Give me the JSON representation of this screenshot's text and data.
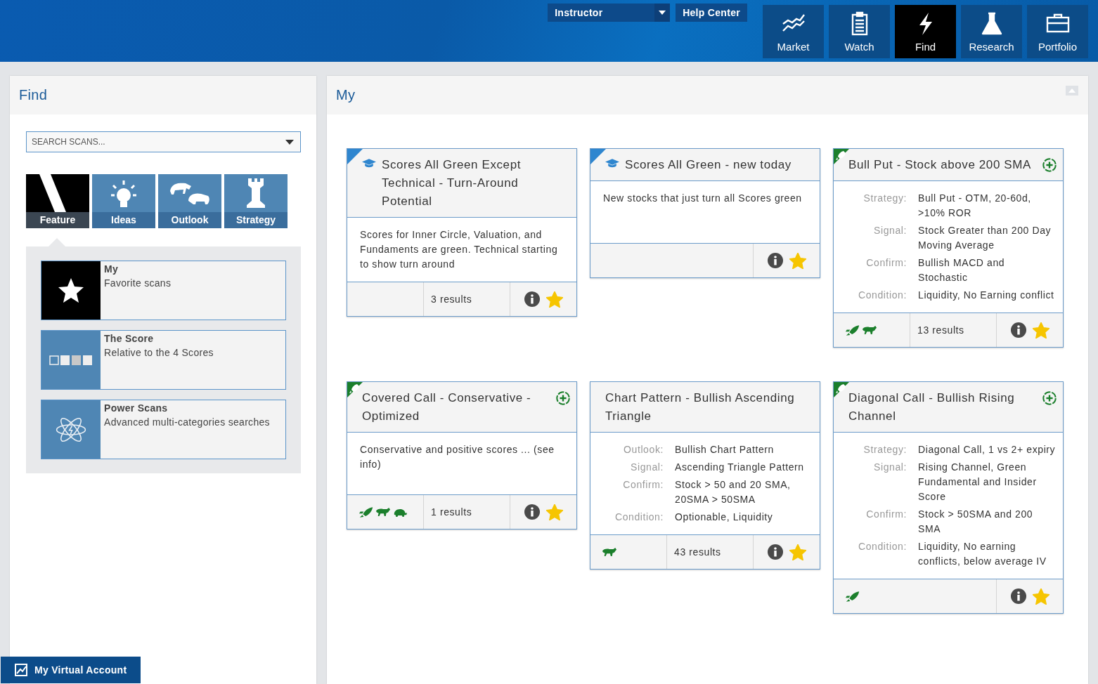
{
  "header": {
    "role_select": {
      "value": "Instructor"
    },
    "help_button": "Help Center",
    "nav": [
      {
        "label": "Market",
        "selected": false
      },
      {
        "label": "Watch",
        "selected": false
      },
      {
        "label": "Find",
        "selected": true
      },
      {
        "label": "Research",
        "selected": false
      },
      {
        "label": "Portfolio",
        "selected": false
      }
    ]
  },
  "sidebar": {
    "title": "Find",
    "search": {
      "placeholder": "SEARCH SCANS..."
    },
    "categories": [
      {
        "label": "Feature",
        "selected": true
      },
      {
        "label": "Ideas",
        "selected": false
      },
      {
        "label": "Outlook",
        "selected": false
      },
      {
        "label": "Strategy",
        "selected": false
      }
    ],
    "items": [
      {
        "title": "My",
        "subtitle": "Favorite scans",
        "selected": true
      },
      {
        "title": "The Score",
        "subtitle": "Relative to the 4 Scores",
        "selected": false
      },
      {
        "title": "Power Scans",
        "subtitle": "Advanced multi-categories searches",
        "selected": false
      }
    ]
  },
  "main": {
    "title": "My",
    "cards": [
      {
        "title": "Scores All Green Except Technical - Turn-Around Potential",
        "kind": "education",
        "description": "Scores for Inner Circle, Valuation, and Fundaments are green. Technical starting to show turn around",
        "results": "3 results",
        "favorite": true
      },
      {
        "title": "Scores All Green - new today",
        "kind": "education",
        "description": "New stocks that just turn all Scores green",
        "favorite": true
      },
      {
        "title": "Bull Put - Stock above 200 SMA",
        "kind": "strategy",
        "fields": [
          {
            "label": "Strategy:",
            "value": "Bull Put - OTM, 20-60d, >10% ROR"
          },
          {
            "label": "Signal:",
            "value": "Stock Greater than 200 Day Moving Average"
          },
          {
            "label": "Confirm:",
            "value": "Bullish MACD and Stochastic"
          },
          {
            "label": "Condition:",
            "value": "Liquidity, No Earning conflict"
          }
        ],
        "tags": [
          {
            "kind": "rocket"
          },
          {
            "kind": "bull"
          }
        ],
        "results": "13 results",
        "favorite": true
      },
      {
        "title": "Covered Call - Conservative - Optimized",
        "kind": "strategy",
        "description": "Conservative and positive scores ... (see info)",
        "tags": [
          {
            "kind": "rocket"
          },
          {
            "kind": "bull"
          },
          {
            "kind": "turtle"
          }
        ],
        "results": "1 results",
        "favorite": true
      },
      {
        "title": "Chart Pattern - Bullish Ascending Triangle",
        "kind": "pattern",
        "fields": [
          {
            "label": "Outlook:",
            "value": "Bullish Chart Pattern"
          },
          {
            "label": "Signal:",
            "value": "Ascending Triangle Pattern"
          },
          {
            "label": "Confirm:",
            "value": "Stock > 50 and 20 SMA, 20SMA > 50SMA"
          },
          {
            "label": "Condition:",
            "value": "Optionable, Liquidity"
          }
        ],
        "tags": [
          {
            "kind": "bull"
          }
        ],
        "results": "43 results",
        "favorite": true
      },
      {
        "title": "Diagonal Call - Bullish Rising Channel",
        "kind": "strategy",
        "fields": [
          {
            "label": "Strategy:",
            "value": "Diagonal Call, 1 vs 2+ expiry"
          },
          {
            "label": "Signal:",
            "value": "Rising Channel, Green Fundamental and Insider Score"
          },
          {
            "label": "Confirm:",
            "value": "Stock > 50SMA and 200 SMA"
          },
          {
            "label": "Condition:",
            "value": "Liquidity, No earning conflicts, below average IV"
          }
        ],
        "tags": [
          {
            "kind": "rocket"
          }
        ],
        "favorite": true
      }
    ]
  },
  "virtual_account": "My Virtual Account"
}
